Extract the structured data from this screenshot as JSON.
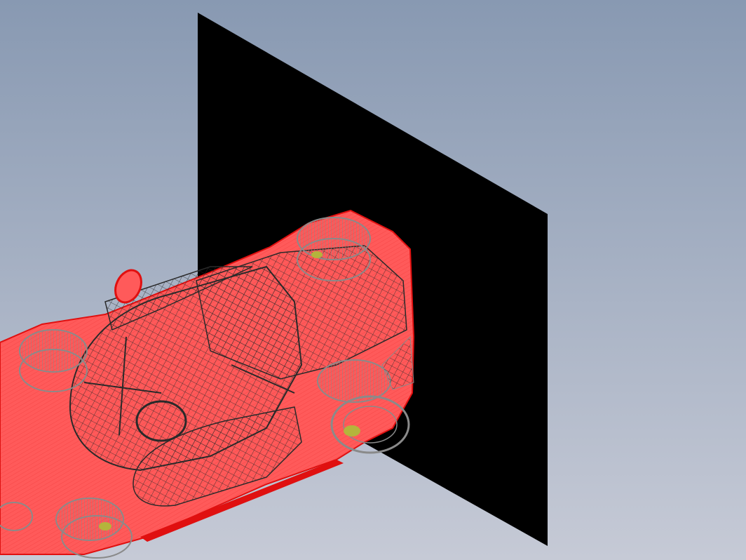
{
  "viewport": {
    "background_top": "#8899b2",
    "background_bottom": "#c6cad6"
  },
  "model": {
    "plane_color": "#000000",
    "body_color": "#ff5a5a",
    "body_edge_color": "#e01010",
    "wire_color": "#2a2a2a",
    "wheel_wire_color": "#8a8a8a",
    "accent_color": "#b4b43c"
  }
}
